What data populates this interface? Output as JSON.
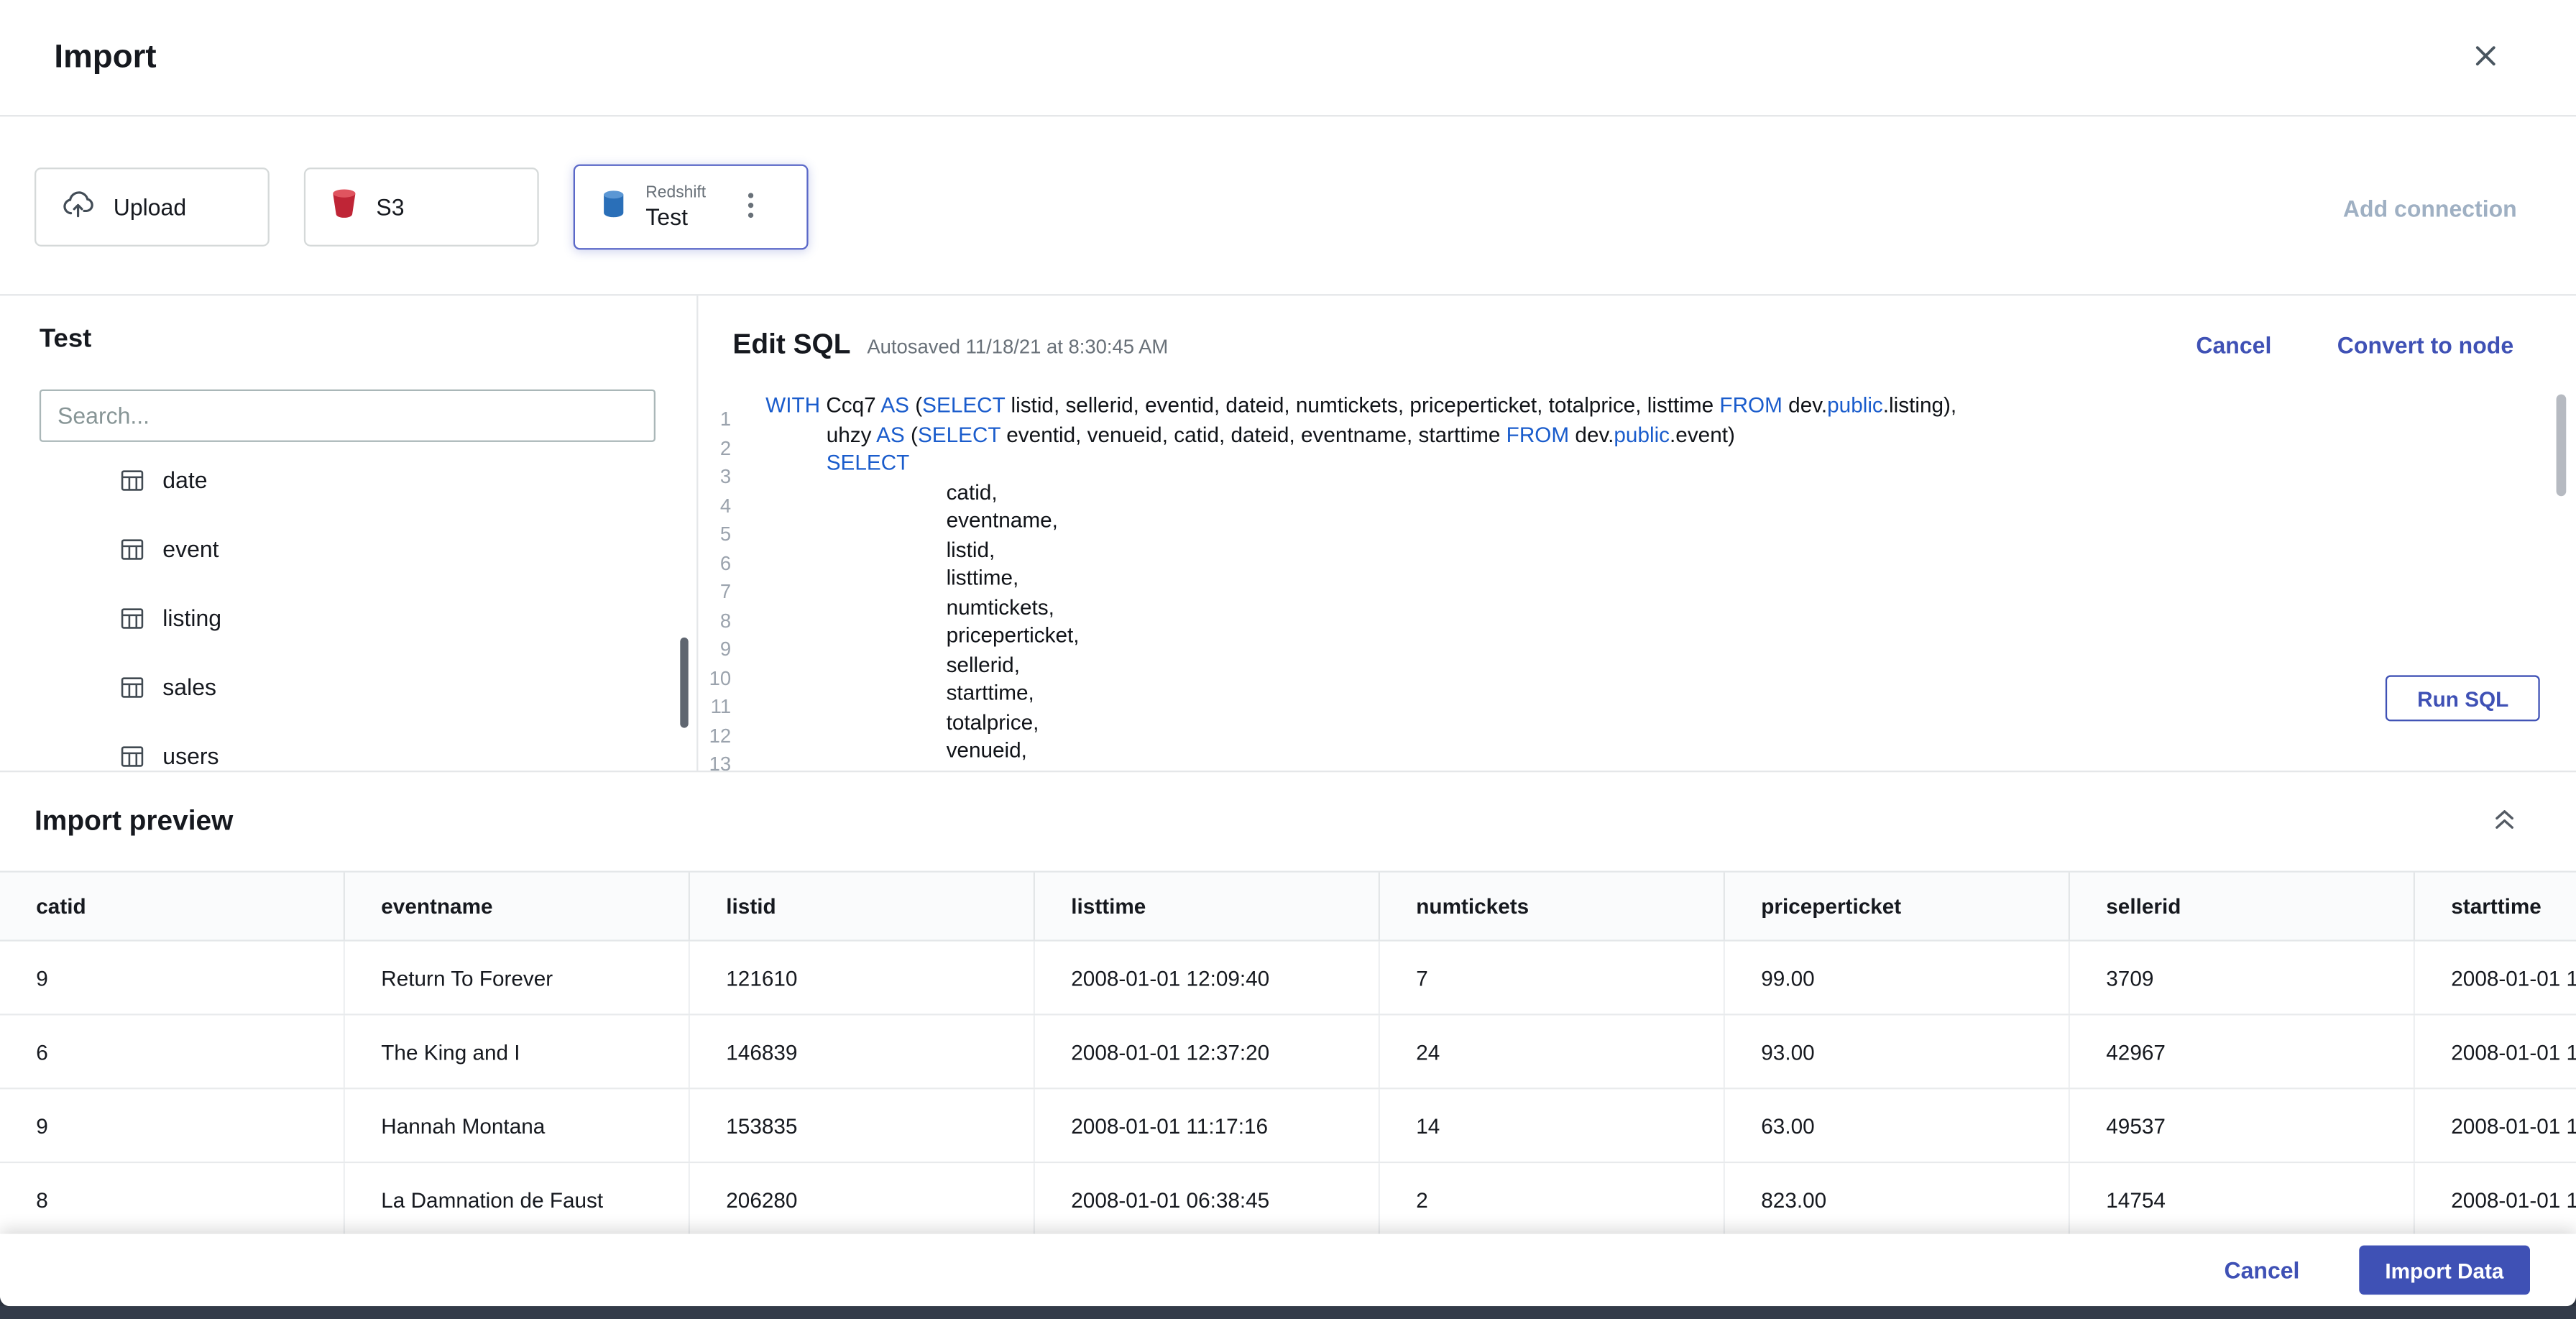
{
  "accent": "#3f51b5",
  "colors": {
    "accent": "#3f51b5",
    "sql_keyword": "#1a5ccc",
    "selected_card_border": "#5a68c8",
    "s3_icon_red": "#bf2536",
    "redshift_icon_blue": "#2a6fb8",
    "add_connection_text": "#9fb0c3"
  },
  "icons": [
    "close-icon",
    "cloud-upload-icon",
    "s3-bucket-icon",
    "redshift-database-icon",
    "kebab-menu-icon",
    "table-icon",
    "collapse-double-chevron-icon"
  ],
  "modal": {
    "title": "Import"
  },
  "connections": {
    "upload_label": "Upload",
    "s3_label": "S3",
    "redshift_type": "Redshift",
    "redshift_name": "Test",
    "add_connection_label": "Add connection"
  },
  "sidebar": {
    "title": "Test",
    "search_placeholder": "Search...",
    "tables": [
      "date",
      "event",
      "listing",
      "sales",
      "users"
    ]
  },
  "sql_editor": {
    "title": "Edit SQL",
    "autosave_text": "Autosaved 11/18/21 at 8:30:45 AM",
    "cancel_label": "Cancel",
    "convert_label": "Convert to node",
    "run_label": "Run SQL",
    "keyword_color": "#1a5ccc",
    "lines": [
      {
        "indent": 0,
        "segments": [
          {
            "t": "WITH ",
            "kw": true
          },
          {
            "t": "Ccq7 "
          },
          {
            "t": "AS ",
            "kw": true
          },
          {
            "t": "("
          },
          {
            "t": "SELECT ",
            "kw": true
          },
          {
            "t": "listid, sellerid, eventid, dateid, numtickets, priceperticket, totalprice, listtime "
          },
          {
            "t": "FROM ",
            "kw": true
          },
          {
            "t": "dev."
          },
          {
            "t": "public",
            "kw": true
          },
          {
            "t": ".listing),"
          }
        ]
      },
      {
        "indent": 37,
        "segments": [
          {
            "t": "uhzy "
          },
          {
            "t": "AS ",
            "kw": true
          },
          {
            "t": "("
          },
          {
            "t": "SELECT ",
            "kw": true
          },
          {
            "t": "eventid, venueid, catid, dateid, eventname, starttime "
          },
          {
            "t": "FROM ",
            "kw": true
          },
          {
            "t": "dev."
          },
          {
            "t": "public",
            "kw": true
          },
          {
            "t": ".event)"
          }
        ]
      },
      {
        "indent": 37,
        "segments": [
          {
            "t": "SELECT",
            "kw": true
          }
        ]
      },
      {
        "indent": 110,
        "segments": [
          {
            "t": "catid,"
          }
        ]
      },
      {
        "indent": 110,
        "segments": [
          {
            "t": "eventname,"
          }
        ]
      },
      {
        "indent": 110,
        "segments": [
          {
            "t": "listid,"
          }
        ]
      },
      {
        "indent": 110,
        "segments": [
          {
            "t": "listtime,"
          }
        ]
      },
      {
        "indent": 110,
        "segments": [
          {
            "t": "numtickets,"
          }
        ]
      },
      {
        "indent": 110,
        "segments": [
          {
            "t": "priceperticket,"
          }
        ]
      },
      {
        "indent": 110,
        "segments": [
          {
            "t": "sellerid,"
          }
        ]
      },
      {
        "indent": 110,
        "segments": [
          {
            "t": "starttime,"
          }
        ]
      },
      {
        "indent": 110,
        "segments": [
          {
            "t": "totalprice,"
          }
        ]
      },
      {
        "indent": 110,
        "segments": [
          {
            "t": "venueid,"
          }
        ]
      }
    ]
  },
  "preview": {
    "title": "Import preview",
    "columns": [
      "catid",
      "eventname",
      "listid",
      "listtime",
      "numtickets",
      "priceperticket",
      "sellerid",
      "starttime"
    ],
    "rows": [
      [
        "9",
        "Return To Forever",
        "121610",
        "2008-01-01 12:09:40",
        "7",
        "99.00",
        "3709",
        "2008-01-01 1"
      ],
      [
        "6",
        "The King and I",
        "146839",
        "2008-01-01 12:37:20",
        "24",
        "93.00",
        "42967",
        "2008-01-01 1"
      ],
      [
        "9",
        "Hannah Montana",
        "153835",
        "2008-01-01 11:17:16",
        "14",
        "63.00",
        "49537",
        "2008-01-01 1"
      ],
      [
        "8",
        "La Damnation de Faust",
        "206280",
        "2008-01-01 06:38:45",
        "2",
        "823.00",
        "14754",
        "2008-01-01 1"
      ]
    ]
  },
  "footer": {
    "cancel_label": "Cancel",
    "import_label": "Import Data"
  }
}
